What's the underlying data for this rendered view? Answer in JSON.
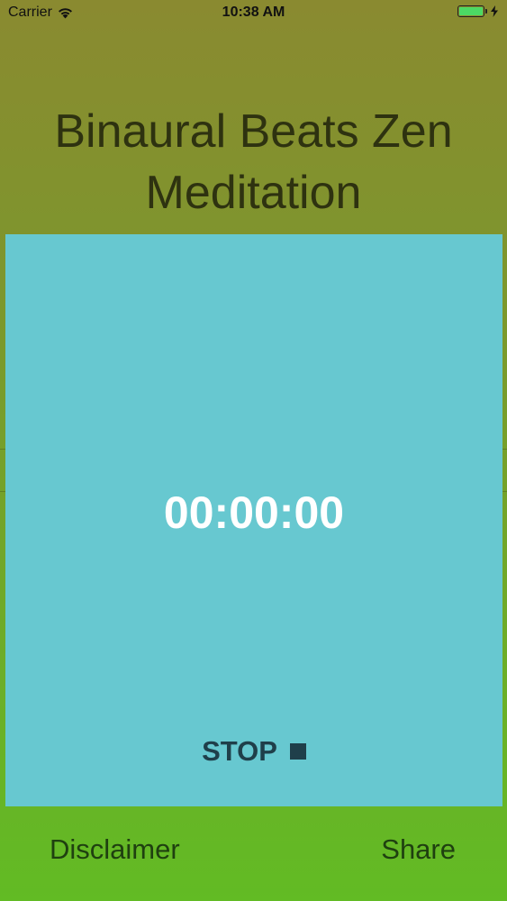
{
  "status_bar": {
    "carrier": "Carrier",
    "time": "10:38 AM",
    "battery_level": 1.0
  },
  "header": {
    "title_line1": "Binaural Beats Zen",
    "title_line2": "Meditation"
  },
  "timer": {
    "display": "00:00:00",
    "stop_label": "STOP"
  },
  "bottom_bar": {
    "disclaimer_label": "Disclaimer",
    "share_label": "Share"
  },
  "colors": {
    "panel": "#67c8d0",
    "stop_text": "#1f3f4a",
    "title_text": "#2e3210",
    "battery": "#4cd964"
  }
}
